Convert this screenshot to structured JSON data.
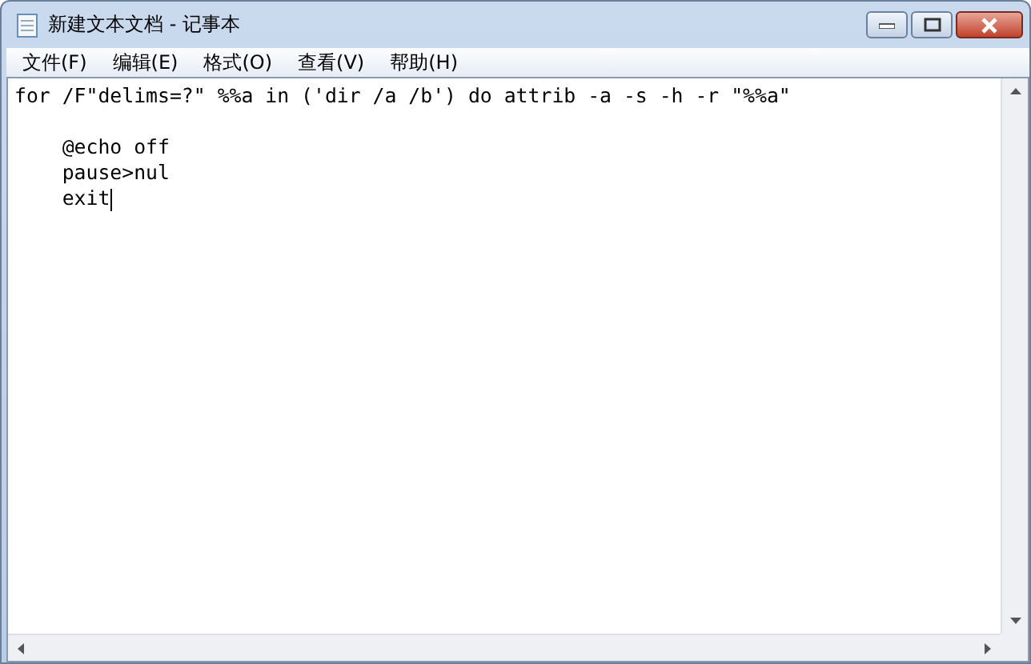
{
  "window": {
    "title": "新建文本文档 - 记事本"
  },
  "menu": [
    {
      "label": "文件(F)"
    },
    {
      "label": "编辑(E)"
    },
    {
      "label": "格式(O)"
    },
    {
      "label": "查看(V)"
    },
    {
      "label": "帮助(H)"
    }
  ],
  "editor": {
    "paragraphs": [
      [
        "for /F\"delims=?\" %%a in ('dir /a /b') do attrib -a -s -h -r \"%%a\""
      ],
      [
        "    @echo off",
        "    pause>nul",
        "    exit"
      ]
    ]
  }
}
